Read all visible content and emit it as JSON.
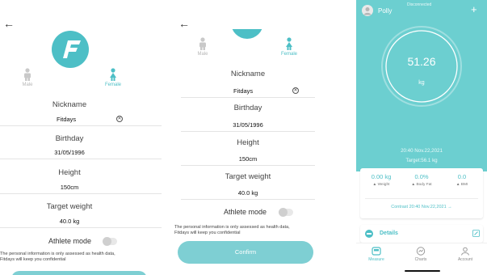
{
  "screen1": {
    "gender_male": "Male",
    "gender_female": "Female",
    "nickname_label": "Nickname",
    "nickname_value": "Fitdays",
    "clear_glyph": "✕",
    "birthday_label": "Birthday",
    "birthday_value": "31/05/1996",
    "height_label": "Height",
    "height_value": "150cm",
    "target_label": "Target weight",
    "target_value": "40.0 kg",
    "athlete_label": "Athlete mode",
    "privacy_line1": "The personal information is only assessed as health data,",
    "privacy_line2": "Fitdays will keep you confidential"
  },
  "screen2": {
    "gender_male": "Male",
    "gender_female": "Female",
    "nickname_label": "Nickname",
    "nickname_value": "Fitdays",
    "clear_glyph": "✕",
    "birthday_label": "Birthday",
    "birthday_value": "31/05/1996",
    "height_label": "Height",
    "height_value": "150cm",
    "target_label": "Target weight",
    "target_value": "40.0 kg",
    "athlete_label": "Athlete mode",
    "privacy_line1": "The personal information is only assessed as health data,",
    "privacy_line2": "Fitdays will keep you confidential",
    "confirm_label": "Confirm"
  },
  "screen3": {
    "status": "Disconnected",
    "user_name": "Polly",
    "add_glyph": "+",
    "weight_value": "51.26",
    "weight_unit": "kg",
    "measure_datetime": "20:40 Nov.22,2021",
    "target_text": "Target:56.1 kg",
    "stats": [
      {
        "value": "0.00 kg",
        "label": "▲ Weight"
      },
      {
        "value": "0.0%",
        "label": "▲ Body Fat"
      },
      {
        "value": "0.0",
        "label": "▲ BMI"
      }
    ],
    "contrast_text": "Contrast 20:40 Nov.22,2021 →",
    "details_label": "Details",
    "tabs": [
      {
        "label": "Measure"
      },
      {
        "label": "Charts"
      },
      {
        "label": "Account"
      }
    ]
  },
  "colors": {
    "accent": "#4dbfc6",
    "header_bg": "#6ccfd0",
    "confirm_bg": "#7ecfd3"
  }
}
